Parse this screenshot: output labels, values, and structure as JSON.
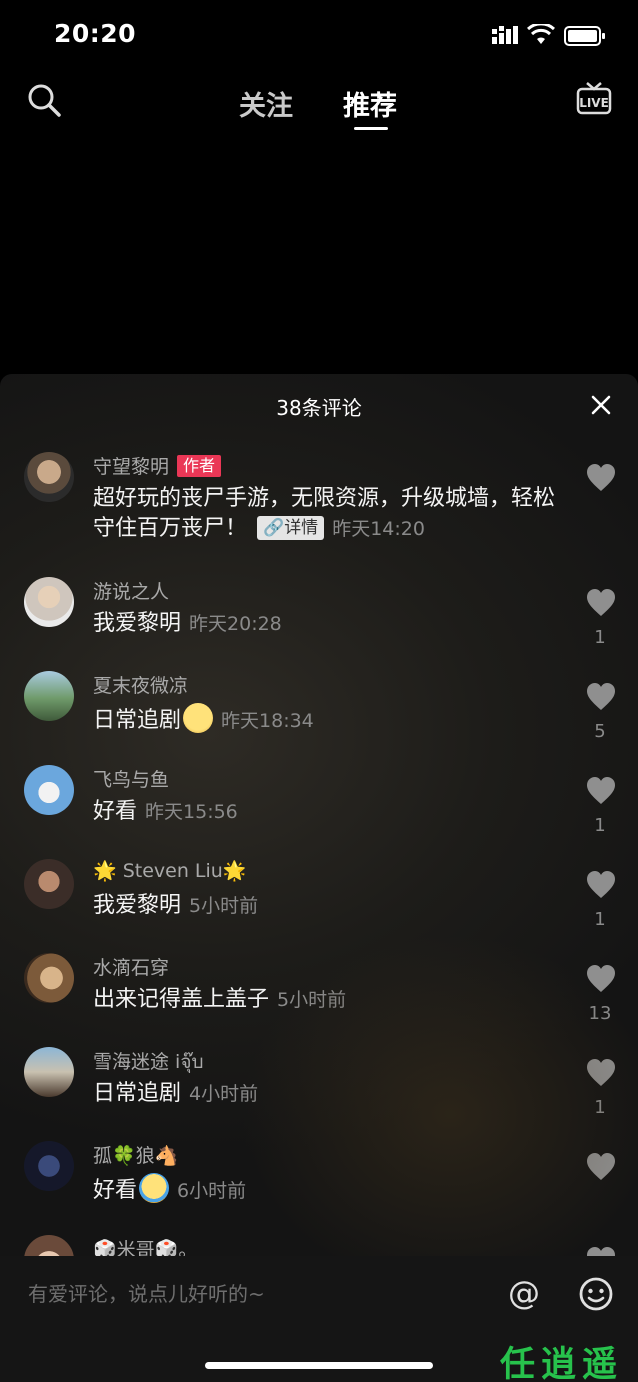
{
  "status": {
    "time": "20:20"
  },
  "nav": {
    "tabs": [
      "关注",
      "推荐"
    ],
    "live_label": "LIVE"
  },
  "sheet": {
    "title": "38条评论",
    "comments": [
      {
        "name": "守望黎明",
        "badge": "作者",
        "text": "超好玩的丧尸手游，无限资源，升级城墙，轻松守住百万丧尸！",
        "detail": "详情",
        "time": "昨天14:20",
        "likes": ""
      },
      {
        "name": "游说之人",
        "text": "我爱黎明",
        "time": "昨天20:28",
        "likes": "1"
      },
      {
        "name": "夏末夜微凉",
        "text": "日常追剧",
        "time": "昨天18:34",
        "likes": "5"
      },
      {
        "name": "飞鸟与鱼",
        "text": "好看",
        "time": "昨天15:56",
        "likes": "1"
      },
      {
        "name": "🌟 Steven Liu🌟",
        "text": "我爱黎明",
        "time": "5小时前",
        "likes": "1"
      },
      {
        "name": "水滴石穿",
        "text": "出来记得盖上盖子",
        "time": "5小时前",
        "likes": "13"
      },
      {
        "name": "雪海迷途  iจุ๊บ",
        "text": "日常追剧",
        "time": "4小时前",
        "likes": "1"
      },
      {
        "name": "孤🍀狼🐴",
        "text": "好看",
        "time": "6小时前",
        "likes": ""
      },
      {
        "name": "🎲米哥🎲。",
        "text": "",
        "time": "",
        "likes": ""
      }
    ]
  },
  "input": {
    "placeholder": "有爱评论，说点儿好听的~",
    "at": "@"
  },
  "watermark": "任逍遥",
  "colors": {
    "author_badge": "#ea3756",
    "watermark": "#27c24c"
  }
}
